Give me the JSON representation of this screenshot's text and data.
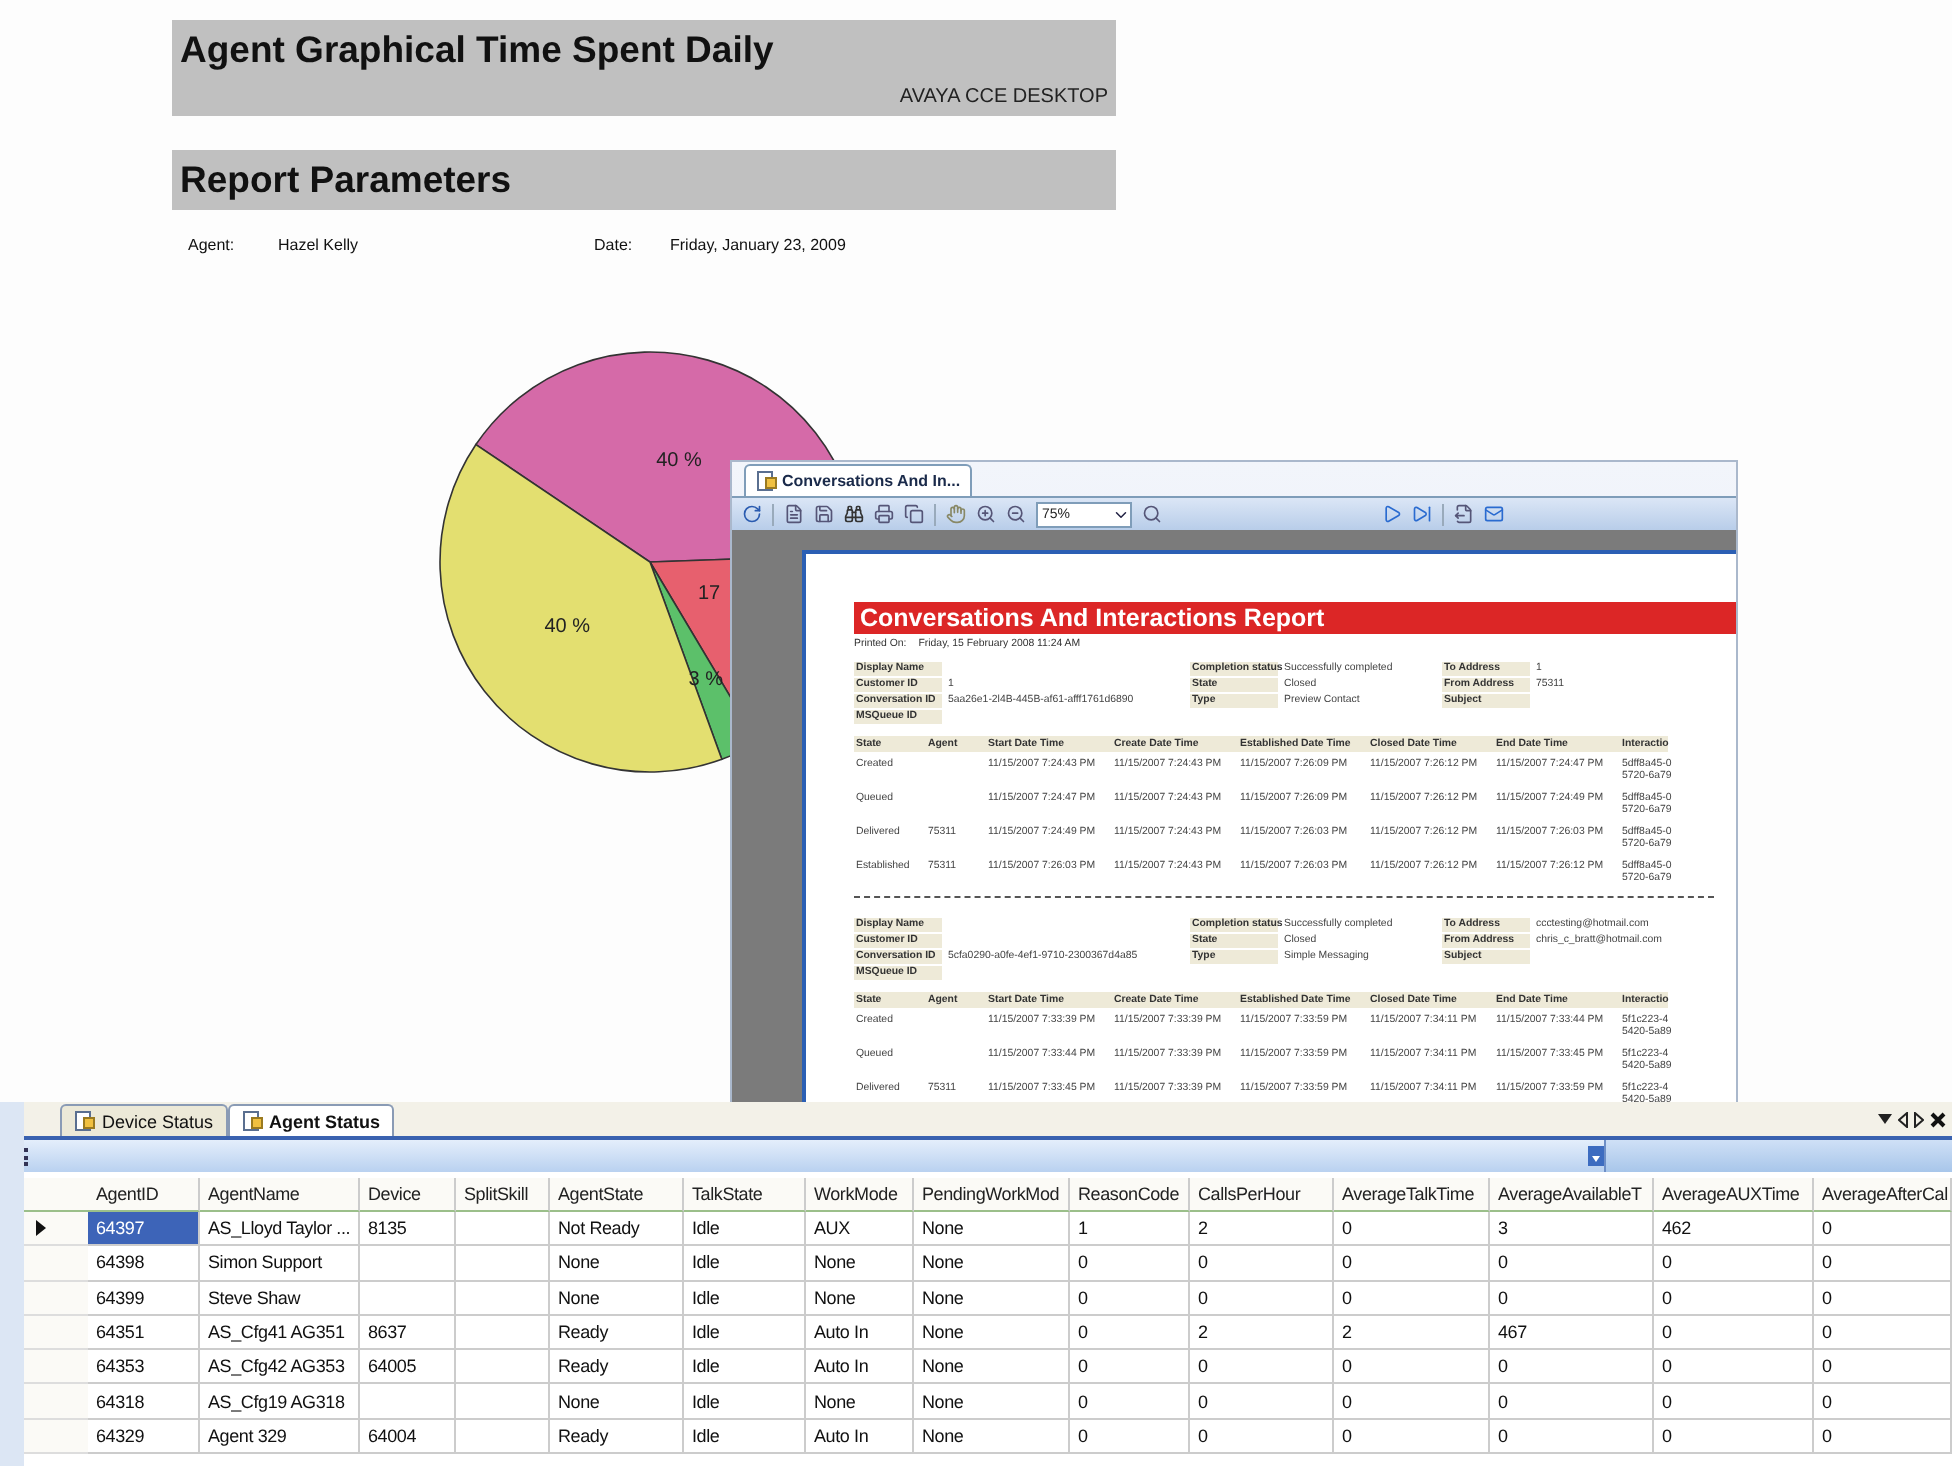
{
  "report": {
    "title": "Agent Graphical Time Spent Daily",
    "subtitle": "AVAYA CCE DESKTOP",
    "section": "Report Parameters",
    "params": [
      {
        "label": "Agent:",
        "value": "Hazel Kelly"
      },
      {
        "label": "Date:",
        "value": "Friday, January 23, 2009"
      }
    ],
    "chart_data": {
      "type": "pie",
      "values": [
        40,
        17,
        3,
        40
      ],
      "value_labels": [
        "40 %",
        "17",
        "3 %",
        "40 %"
      ]
    }
  },
  "viewer": {
    "tab": "Conversations And In...",
    "zoom": "75%",
    "document": {
      "title": "Conversations And Interactions Report",
      "printed_label": "Printed On:",
      "printed_value": "Friday, 15 February 2008 11:24 AM",
      "conversations": [
        {
          "left": [
            {
              "label": "Display Name"
            },
            {
              "label": "Customer ID",
              "value": "1"
            },
            {
              "label": "Conversation ID",
              "value": "5aa26e1-2l4B-445B-af61-afff1761d6890"
            },
            {
              "label": "MSQueue ID"
            }
          ],
          "middle": [
            {
              "label": "Completion status",
              "value": "Successfully completed"
            },
            {
              "label": "State",
              "value": "Closed"
            },
            {
              "label": "Type",
              "value": "Preview Contact"
            }
          ],
          "right": [
            {
              "label": "To Address",
              "value": "1"
            },
            {
              "label": "From Address",
              "value": "75311"
            },
            {
              "label": "Subject"
            }
          ],
          "columns": [
            "State",
            "Agent",
            "Start Date Time",
            "Create Date Time",
            "Established Date Time",
            "Closed Date Time",
            "End Date Time",
            "Interactio"
          ],
          "rows": [
            [
              "Created",
              null,
              "11/15/2007 7:24:43 PM",
              "11/15/2007 7:24:43 PM",
              "11/15/2007 7:26:09 PM",
              "11/15/2007 7:26:12 PM",
              "11/15/2007 7:24:47 PM",
              "5dff8a45-0\n5720-6a79"
            ],
            [
              "Queued",
              null,
              "11/15/2007 7:24:47 PM",
              "11/15/2007 7:24:43 PM",
              "11/15/2007 7:26:09 PM",
              "11/15/2007 7:26:12 PM",
              "11/15/2007 7:24:49 PM",
              "5dff8a45-0\n5720-6a79"
            ],
            [
              "Delivered",
              "75311",
              "11/15/2007 7:24:49 PM",
              "11/15/2007 7:24:43 PM",
              "11/15/2007 7:26:03 PM",
              "11/15/2007 7:26:12 PM",
              "11/15/2007 7:26:03 PM",
              "5dff8a45-0\n5720-6a79"
            ],
            [
              "Established",
              "75311",
              "11/15/2007 7:26:03 PM",
              "11/15/2007 7:24:43 PM",
              "11/15/2007 7:26:03 PM",
              "11/15/2007 7:26:12 PM",
              "11/15/2007 7:26:12 PM",
              "5dff8a45-0\n5720-6a79"
            ]
          ]
        },
        {
          "left": [
            {
              "label": "Display Name"
            },
            {
              "label": "Customer ID"
            },
            {
              "label": "Conversation ID",
              "value": "5cfa0290-a0fe-4ef1-9710-2300367d4a85"
            },
            {
              "label": "MSQueue ID"
            }
          ],
          "middle": [
            {
              "label": "Completion status",
              "value": "Successfully completed"
            },
            {
              "label": "State",
              "value": "Closed"
            },
            {
              "label": "Type",
              "value": "Simple Messaging"
            }
          ],
          "right": [
            {
              "label": "To Address",
              "value": "ccctesting@hotmail.com"
            },
            {
              "label": "From Address",
              "value": "chris_c_bratt@hotmail.com"
            },
            {
              "label": "Subject"
            }
          ],
          "columns": [
            "State",
            "Agent",
            "Start Date Time",
            "Create Date Time",
            "Established Date Time",
            "Closed Date Time",
            "End Date Time",
            "Interactio"
          ],
          "rows": [
            [
              "Created",
              null,
              "11/15/2007 7:33:39 PM",
              "11/15/2007 7:33:39 PM",
              "11/15/2007 7:33:59 PM",
              "11/15/2007 7:34:11 PM",
              "11/15/2007 7:33:44 PM",
              "5f1c223-4\n5420-5a89"
            ],
            [
              "Queued",
              null,
              "11/15/2007 7:33:44 PM",
              "11/15/2007 7:33:39 PM",
              "11/15/2007 7:33:59 PM",
              "11/15/2007 7:34:11 PM",
              "11/15/2007 7:33:45 PM",
              "5f1c223-4\n5420-5a89"
            ],
            [
              "Delivered",
              "75311",
              "11/15/2007 7:33:45 PM",
              "11/15/2007 7:33:39 PM",
              "11/15/2007 7:33:59 PM",
              "11/15/2007 7:34:11 PM",
              "11/15/2007 7:33:59 PM",
              "5f1c223-4\n5420-5a89"
            ]
          ]
        }
      ]
    }
  },
  "panel": {
    "tabs": [
      {
        "label": "Device Status",
        "selected": false
      },
      {
        "label": "Agent Status",
        "selected": true
      }
    ],
    "grid": {
      "columns": [
        "AgentID",
        "AgentName",
        "Device",
        "SplitSkill",
        "AgentState",
        "TalkState",
        "WorkMode",
        "PendingWorkMod",
        "ReasonCode",
        "CallsPerHour",
        "AverageTalkTime",
        "AverageAvailableT",
        "AverageAUXTime",
        "AverageAfterCal"
      ],
      "rows": [
        {
          "selected": true,
          "cells": [
            "64397",
            "AS_Lloyd Taylor ...",
            "8135",
            null,
            "Not Ready",
            "Idle",
            "AUX",
            "None",
            "1",
            "2",
            "0",
            "3",
            "462",
            "0"
          ]
        },
        {
          "selected": false,
          "cells": [
            "64398",
            "Simon Support",
            null,
            null,
            "None",
            "Idle",
            "None",
            "None",
            "0",
            "0",
            "0",
            "0",
            "0",
            "0"
          ]
        },
        {
          "selected": false,
          "cells": [
            "64399",
            "Steve Shaw",
            null,
            null,
            "None",
            "Idle",
            "None",
            "None",
            "0",
            "0",
            "0",
            "0",
            "0",
            "0"
          ]
        },
        {
          "selected": false,
          "cells": [
            "64351",
            "AS_Cfg41 AG351",
            "8637",
            null,
            "Ready",
            "Idle",
            "Auto In",
            "None",
            "0",
            "2",
            "2",
            "467",
            "0",
            "0"
          ]
        },
        {
          "selected": false,
          "cells": [
            "64353",
            "AS_Cfg42 AG353",
            "64005",
            null,
            "Ready",
            "Idle",
            "Auto In",
            "None",
            "0",
            "0",
            "0",
            "0",
            "0",
            "0"
          ]
        },
        {
          "selected": false,
          "cells": [
            "64318",
            "AS_Cfg19 AG318",
            null,
            null,
            "None",
            "Idle",
            "None",
            "None",
            "0",
            "0",
            "0",
            "0",
            "0",
            "0"
          ]
        },
        {
          "selected": false,
          "cells": [
            "64329",
            "Agent 329",
            "64004",
            null,
            "Ready",
            "Idle",
            "Auto In",
            "None",
            "0",
            "0",
            "0",
            "0",
            "0",
            "0"
          ]
        }
      ]
    }
  }
}
